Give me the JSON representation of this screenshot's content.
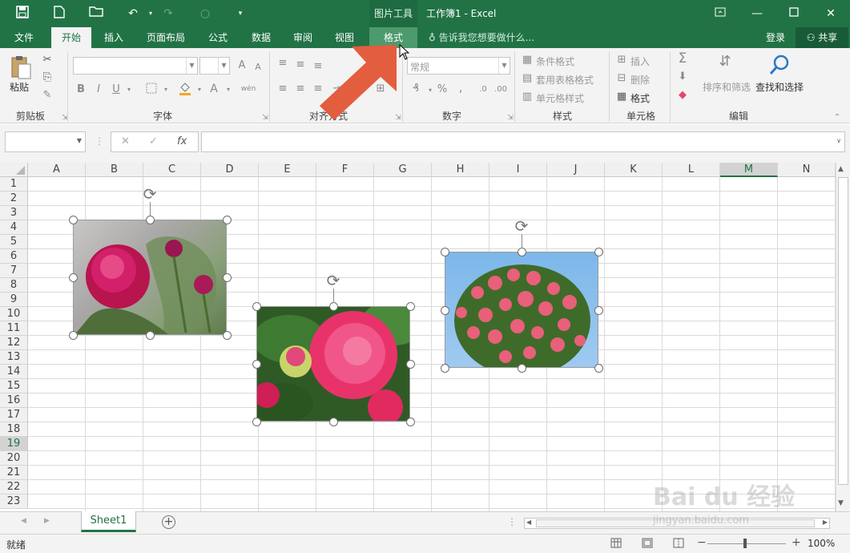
{
  "titlebar": {
    "context_tool": "图片工具",
    "doc_title": "工作簿1 - Excel"
  },
  "tabs": [
    {
      "label": "文件"
    },
    {
      "label": "开始"
    },
    {
      "label": "插入"
    },
    {
      "label": "页面布局"
    },
    {
      "label": "公式"
    },
    {
      "label": "数据"
    },
    {
      "label": "审阅"
    },
    {
      "label": "视图"
    },
    {
      "label": "格式"
    }
  ],
  "tellme": "告诉我您想要做什么...",
  "login": "登录",
  "share": "共享",
  "ribbon": {
    "clipboard": {
      "paste": "粘贴",
      "label": "剪贴板"
    },
    "font": {
      "label": "字体",
      "bold": "B",
      "italic": "I",
      "underline": "U",
      "fontcolor": "A",
      "wen": "wén"
    },
    "align": {
      "label": "对齐方式"
    },
    "number": {
      "label": "数字",
      "format": "常规",
      "percent": "%",
      "comma": ","
    },
    "styles": {
      "label": "样式",
      "cond": "条件格式",
      "table": "套用表格格式",
      "cell": "单元格样式"
    },
    "cells": {
      "label": "单元格",
      "insert": "插入",
      "delete": "删除",
      "format": "格式"
    },
    "edit": {
      "label": "编辑",
      "sort": "排序和筛选",
      "find": "查找和选择"
    }
  },
  "formula": {
    "fx": "fx",
    "value": ""
  },
  "columns": [
    "A",
    "B",
    "C",
    "D",
    "E",
    "F",
    "G",
    "H",
    "I",
    "J",
    "K",
    "L",
    "M",
    "N"
  ],
  "selected_col": "M",
  "rows": [
    "1",
    "2",
    "3",
    "4",
    "5",
    "6",
    "7",
    "8",
    "9",
    "10",
    "11",
    "12",
    "13",
    "14",
    "15",
    "16",
    "17",
    "18",
    "19",
    "20",
    "21",
    "22",
    "23"
  ],
  "selected_row": "19",
  "sheet": {
    "name": "Sheet1",
    "add": "+"
  },
  "status": {
    "ready": "就绪",
    "zoom": "100%"
  },
  "watermark": {
    "brand": "Bai du 经验",
    "url": "jingyan.baidu.com"
  },
  "colors": {
    "excel_green": "#217346",
    "arrow": "#e35d3f"
  }
}
